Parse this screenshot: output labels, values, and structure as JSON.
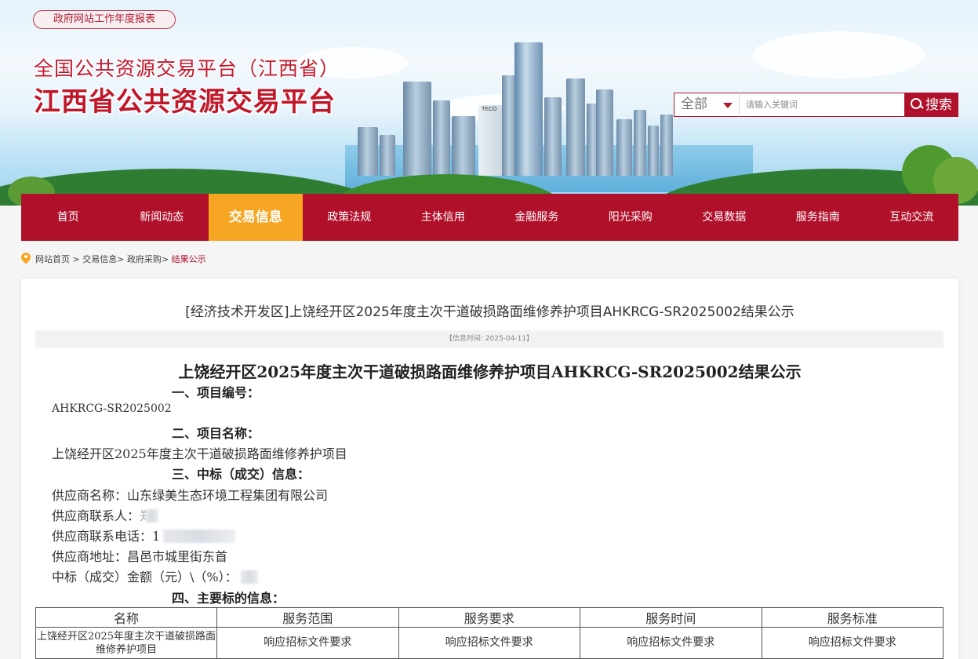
{
  "header": {
    "report_link": "政府网站工作年度报表",
    "subtitle": "全国公共资源交易平台（江西省）",
    "title": "江西省公共资源交易平台",
    "banner_sign": "TECO"
  },
  "search": {
    "scope": "全部",
    "placeholder": "请输入关键词",
    "button": "搜索"
  },
  "nav": {
    "items": [
      "首页",
      "新闻动态",
      "交易信息",
      "政策法规",
      "主体信用",
      "金融服务",
      "阳光采购",
      "交易数据",
      "服务指南",
      "互动交流"
    ],
    "active": "交易信息"
  },
  "breadcrumb": {
    "home": "网站首页",
    "sep": " > ",
    "level1": "交易信息",
    "level2": "政府采购",
    "current": "结果公示"
  },
  "article": {
    "title": "[经济技术开发区]上饶经开区2025年度主次干道破损路面维修养护项目AHKRCG-SR2025002结果公示",
    "info_time": "【信息时间:   2025-04-11】",
    "doc_title": "上饶经开区2025年度主次干道破损路面维修养护项目AHKRCG-SR2025002结果公示",
    "sec1": "一、项目编号：",
    "project_no": "AHKRCG-SR2025002",
    "sec2": "二、项目名称：",
    "project_name": "上饶经开区2025年度主次干道破损路面维修养护项目",
    "sec3": "三、中标（成交）信息：",
    "supplier_name": "供应商名称：山东绿美生态环境工程集团有限公司",
    "supplier_contact_label": "供应商联系人：",
    "supplier_contact_visible": "郑",
    "supplier_phone_label": "供应商联系电话：",
    "supplier_phone_visible": "1",
    "supplier_address": "供应商地址：昌邑市城里街东首",
    "amount_label": "中标（成交）金额（元）\\（%）：",
    "sec4": "四、主要标的信息："
  },
  "table": {
    "headers": [
      "名称",
      "服务范围",
      "服务要求",
      "服务时间",
      "服务标准"
    ],
    "rows": [
      [
        "上饶经开区2025年度主次干道破损路面维修养护项目",
        "响应招标文件要求",
        "响应招标文件要求",
        "响应招标文件要求",
        "响应招标文件要求"
      ]
    ]
  },
  "colors": {
    "brand_red": "#b0102a",
    "active_tab": "#f6a623"
  }
}
